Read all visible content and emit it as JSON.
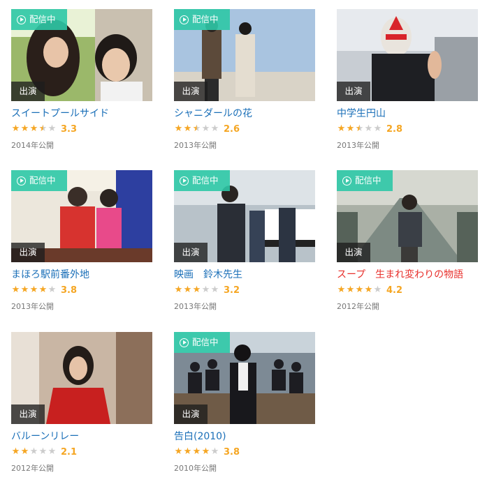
{
  "badges": {
    "streaming": "配信中",
    "role": "出演"
  },
  "colors": {
    "title": "#1a6fb8",
    "title_active": "#e8302c",
    "accent": "#2ec8a6",
    "star": "#f5a623"
  },
  "films": [
    {
      "title": "スイートプールサイド",
      "rating": "3.3",
      "stars": 3.5,
      "year": "2014年公開",
      "streaming": true
    },
    {
      "title": "シャニダールの花",
      "rating": "2.6",
      "stars": 2.5,
      "year": "2013年公開",
      "streaming": true
    },
    {
      "title": "中学生円山",
      "rating": "2.8",
      "stars": 2.5,
      "year": "2013年公開",
      "streaming": false
    },
    {
      "title": "まほろ駅前番外地",
      "rating": "3.8",
      "stars": 4,
      "year": "2013年公開",
      "streaming": true
    },
    {
      "title": "映画　鈴木先生",
      "rating": "3.2",
      "stars": 3,
      "year": "2013年公開",
      "streaming": true
    },
    {
      "title": "スープ　生まれ変わりの物語",
      "rating": "4.2",
      "stars": 4,
      "year": "2012年公開",
      "streaming": true,
      "active": true
    },
    {
      "title": "バルーンリレー",
      "rating": "2.1",
      "stars": 2,
      "year": "2012年公開",
      "streaming": false
    },
    {
      "title": "告白(2010)",
      "rating": "3.8",
      "stars": 4,
      "year": "2010年公開",
      "streaming": true
    }
  ]
}
